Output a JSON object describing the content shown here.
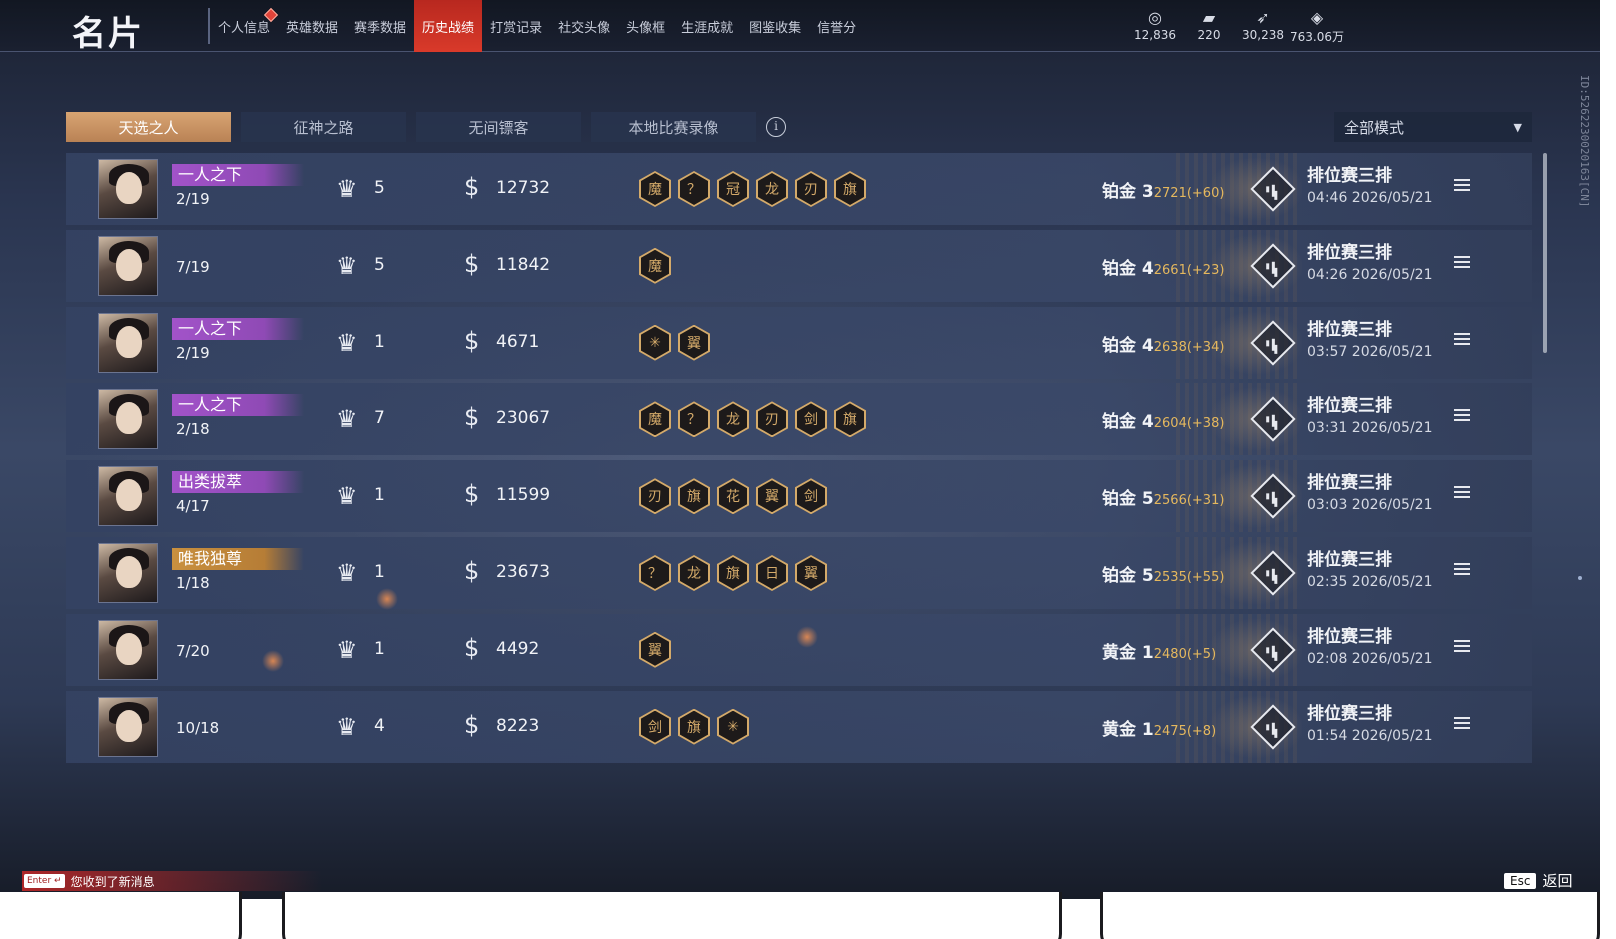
{
  "header": {
    "title": "名片",
    "nav": [
      {
        "label": "个人信息",
        "alert": true
      },
      {
        "label": "英雄数据"
      },
      {
        "label": "赛季数据"
      },
      {
        "label": "历史战绩",
        "active": true
      },
      {
        "label": "打赏记录"
      },
      {
        "label": "社交头像"
      },
      {
        "label": "头像框"
      },
      {
        "label": "生涯成就"
      },
      {
        "label": "图鉴收集"
      },
      {
        "label": "信誉分"
      }
    ],
    "currencies": [
      {
        "icon": "coin-stack-icon",
        "value": "12,836"
      },
      {
        "icon": "gold-ticket-icon",
        "value": "220"
      },
      {
        "icon": "feather-icon",
        "value": "30,238"
      },
      {
        "icon": "diamond-icon",
        "value": "763.06万"
      }
    ]
  },
  "side_id": "ID:5262230020163[CN]",
  "tabs": [
    {
      "label": "天选之人",
      "active": true
    },
    {
      "label": "征神之路"
    },
    {
      "label": "无间镖客"
    },
    {
      "label": "本地比赛录像"
    }
  ],
  "mode_filter": {
    "selected": "全部模式"
  },
  "matches": [
    {
      "title": "一人之下",
      "title_color": "purple",
      "kda": "2/19",
      "crowns": "5",
      "coins": "12732",
      "medals": [
        "魔",
        "？",
        "冠",
        "龙",
        "刃",
        "旗"
      ],
      "rank": "铂金 3",
      "score": "2721(+60)",
      "mode": "排位赛三排",
      "time": "04:46  2026/05/21"
    },
    {
      "title": "",
      "title_color": "",
      "kda": "7/19",
      "crowns": "5",
      "coins": "11842",
      "medals": [
        "魔"
      ],
      "rank": "铂金 4",
      "score": "2661(+23)",
      "mode": "排位赛三排",
      "time": "04:26  2026/05/21"
    },
    {
      "title": "一人之下",
      "title_color": "purple",
      "kda": "2/19",
      "crowns": "1",
      "coins": "4671",
      "medals": [
        "✳",
        "翼"
      ],
      "rank": "铂金 4",
      "score": "2638(+34)",
      "mode": "排位赛三排",
      "time": "03:57  2026/05/21"
    },
    {
      "title": "一人之下",
      "title_color": "purple",
      "kda": "2/18",
      "crowns": "7",
      "coins": "23067",
      "medals": [
        "魔",
        "？",
        "龙",
        "刃",
        "剑",
        "旗"
      ],
      "rank": "铂金 4",
      "score": "2604(+38)",
      "mode": "排位赛三排",
      "time": "03:31  2026/05/21"
    },
    {
      "title": "出类拔萃",
      "title_color": "purple",
      "kda": "4/17",
      "crowns": "1",
      "coins": "11599",
      "medals": [
        "刃",
        "旗",
        "花",
        "翼",
        "剑"
      ],
      "rank": "铂金 5",
      "score": "2566(+31)",
      "mode": "排位赛三排",
      "time": "03:03  2026/05/21"
    },
    {
      "title": "唯我独尊",
      "title_color": "gold",
      "kda": "1/18",
      "crowns": "1",
      "coins": "23673",
      "medals": [
        "？",
        "龙",
        "旗",
        "日",
        "翼"
      ],
      "rank": "铂金 5",
      "score": "2535(+55)",
      "mode": "排位赛三排",
      "time": "02:35  2026/05/21"
    },
    {
      "title": "",
      "title_color": "",
      "kda": "7/20",
      "crowns": "1",
      "coins": "4492",
      "medals": [
        "翼"
      ],
      "rank": "黄金 1",
      "score": "2480(+5)",
      "mode": "排位赛三排",
      "time": "02:08  2026/05/21"
    },
    {
      "title": "",
      "title_color": "",
      "kda": "10/18",
      "crowns": "4",
      "coins": "8223",
      "medals": [
        "剑",
        "旗",
        "✳"
      ],
      "rank": "黄金 1",
      "score": "2475(+8)",
      "mode": "排位赛三排",
      "time": "01:54  2026/05/21"
    }
  ],
  "footer": {
    "enter_key": "Enter ↵",
    "notification": "您收到了新消息",
    "esc_key": "Esc",
    "back_label": "返回"
  }
}
